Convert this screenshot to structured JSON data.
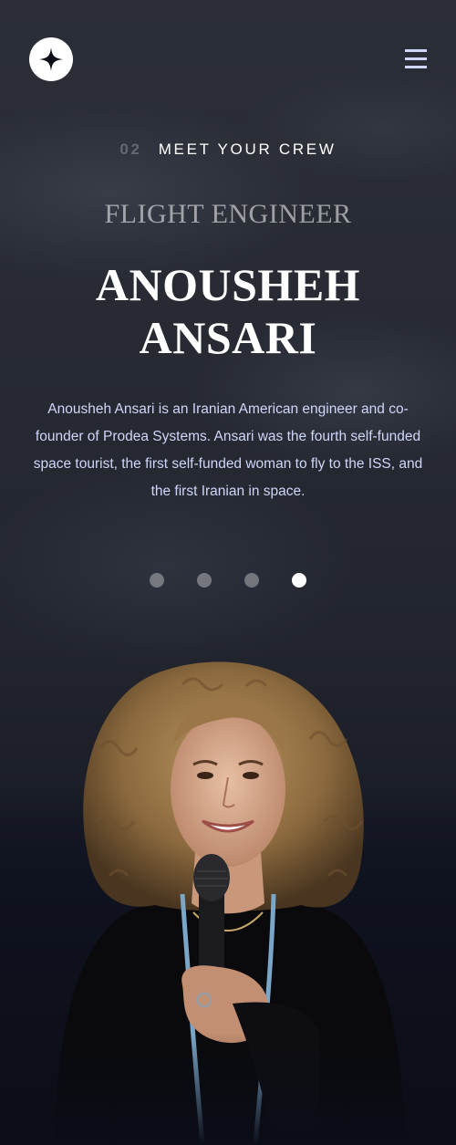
{
  "header": {
    "logo_icon": "star-logo-icon",
    "menu_icon": "hamburger-menu-icon"
  },
  "eyebrow": {
    "number": "02",
    "label": "MEET YOUR CREW"
  },
  "crew": {
    "role": "FLIGHT ENGINEER",
    "name_line1": "ANOUSHEH",
    "name_line2": "ANSARI",
    "bio": "Anousheh Ansari is an Iranian American engineer and co-founder of Prodea Systems. Ansari was the fourth self-funded space tourist, the first self-funded woman to fly to the ISS, and the first Iranian in space."
  },
  "carousel": {
    "count": 4,
    "active_index": 3
  },
  "colors": {
    "background": "#0b0d17",
    "accent": "#d0d6f9",
    "white": "#ffffff"
  }
}
